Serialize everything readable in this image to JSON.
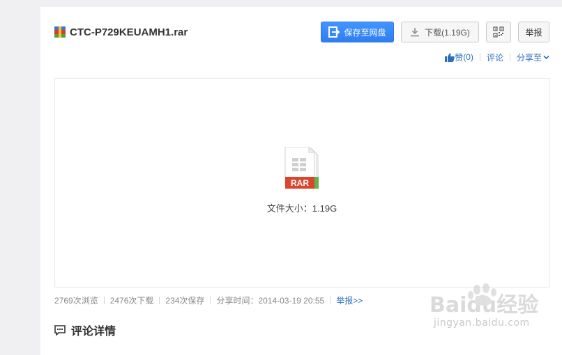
{
  "file": {
    "name": "CTC-P729KEUAMH1.rar",
    "type_label": "RAR",
    "size_label": "文件大小：",
    "size_value": "1.19G"
  },
  "toolbar": {
    "save_label": "保存至网盘",
    "download_label": "下载(1.19G)",
    "report_label": "举报"
  },
  "actions": {
    "like_label": "赞",
    "like_count": "(0)",
    "comment_label": "评论",
    "share_label": "分享至"
  },
  "stats": {
    "views": "2769次浏览",
    "downloads": "2476次下载",
    "saves": "234次保存",
    "share_time": "分享时间：2014-03-19 20:55",
    "report_link": "举报>>"
  },
  "comments": {
    "title": "评论详情"
  },
  "watermark": {
    "brand": "Baidu经验",
    "url": "jingyan.baidu.com"
  },
  "colors": {
    "accent": "#3b8cff",
    "link": "#2a6fc0",
    "rar_red": "#d8462e",
    "rar_green": "#62b34a"
  }
}
